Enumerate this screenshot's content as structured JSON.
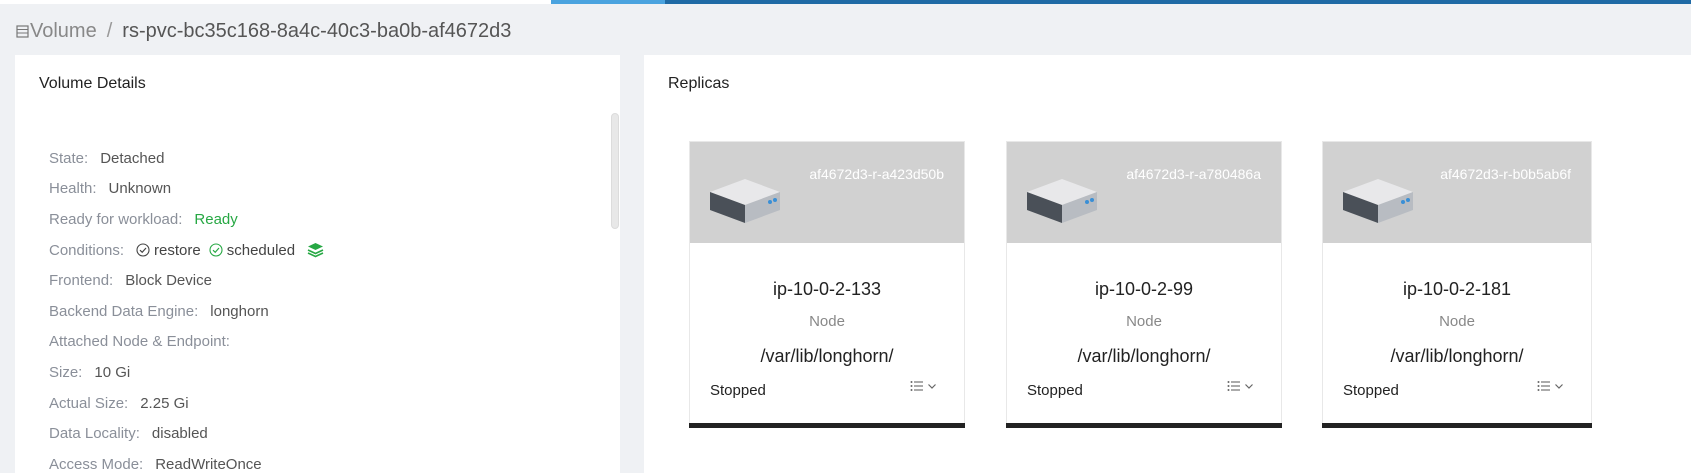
{
  "breadcrumb": {
    "parent": "Volume",
    "separator": "/",
    "current": "rs-pvc-bc35c168-8a4c-40c3-ba0b-af4672d3"
  },
  "details": {
    "title": "Volume Details",
    "rows": [
      {
        "label": "State:",
        "value": "Detached"
      },
      {
        "label": "Health:",
        "value": "Unknown"
      },
      {
        "label": "Ready for workload:",
        "value": "Ready",
        "value_color": "#27a844"
      },
      {
        "label": "Conditions:",
        "value": ""
      },
      {
        "label": "Frontend:",
        "value": "Block Device"
      },
      {
        "label": "Backend Data Engine:",
        "value": "longhorn"
      },
      {
        "label": "Attached Node & Endpoint:",
        "value": ""
      },
      {
        "label": "Size:",
        "value": "10 Gi"
      },
      {
        "label": "Actual Size:",
        "value": "2.25 Gi"
      },
      {
        "label": "Data Locality:",
        "value": "disabled"
      },
      {
        "label": "Access Mode:",
        "value": "ReadWriteOnce"
      }
    ],
    "conditions": [
      {
        "name": "restore",
        "icon": "check-circle-icon"
      },
      {
        "name": "scheduled",
        "icon": "check-circle-icon",
        "color": "#27a844"
      }
    ]
  },
  "replicas": {
    "title": "Replicas",
    "items": [
      {
        "name": "af4672d3-r-a423d50b",
        "node": "ip-10-0-2-133",
        "node_label": "Node",
        "path": "/var/lib/longhorn/",
        "status": "Stopped"
      },
      {
        "name": "af4672d3-r-a780486a",
        "node": "ip-10-0-2-99",
        "node_label": "Node",
        "path": "/var/lib/longhorn/",
        "status": "Stopped"
      },
      {
        "name": "af4672d3-r-b0b5ab6f",
        "node": "ip-10-0-2-181",
        "node_label": "Node",
        "path": "/var/lib/longhorn/",
        "status": "Stopped"
      }
    ]
  },
  "colors": {
    "topbar": "#1f6aa5",
    "ready": "#27a844",
    "card_header": "#d1d1d1"
  }
}
